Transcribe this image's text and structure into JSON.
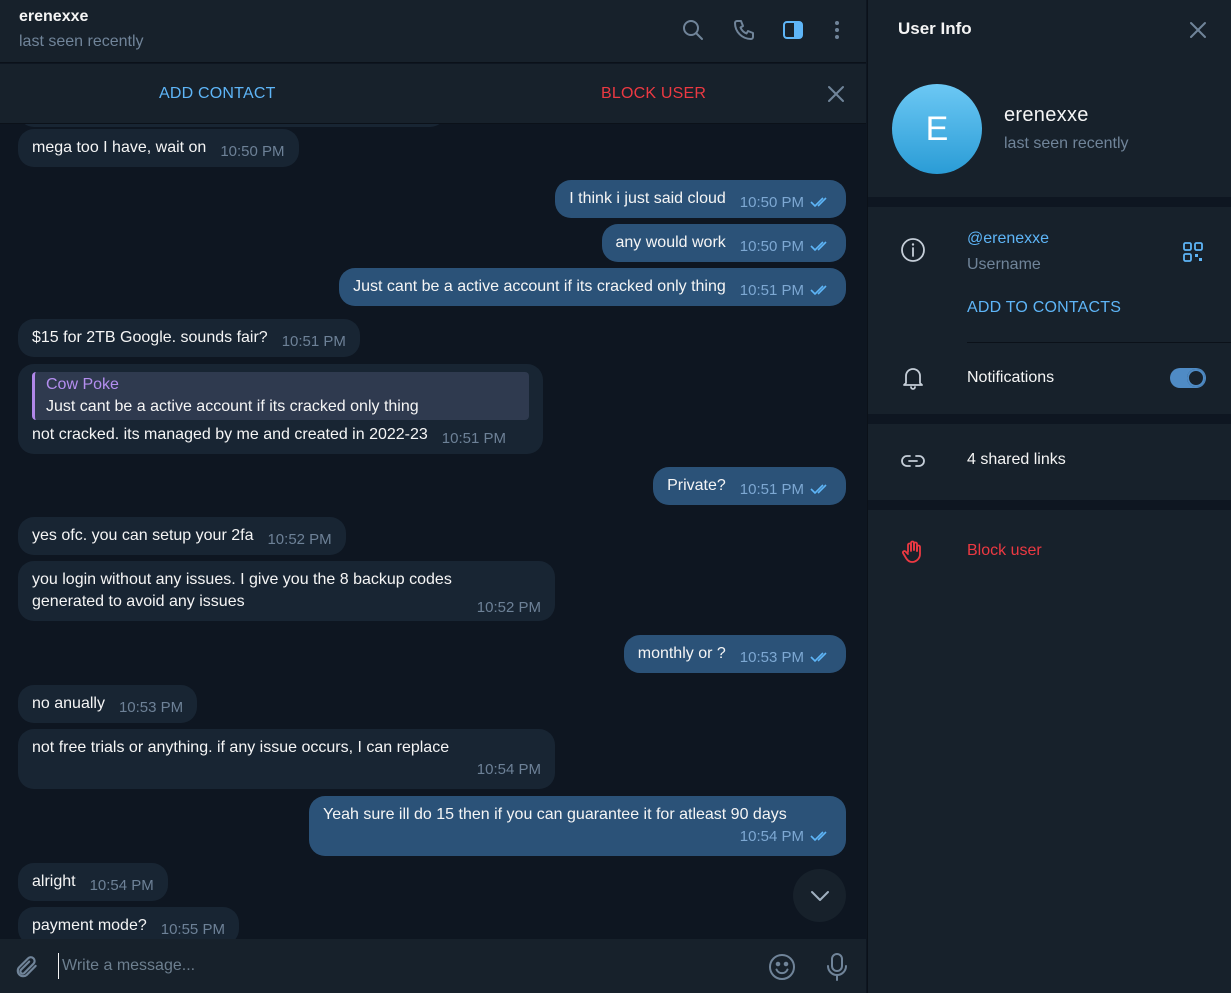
{
  "header": {
    "title": "erenexxe",
    "status": "last seen recently"
  },
  "action_bar": {
    "add_contact": "ADD CONTACT",
    "block_user": "BLOCK USER"
  },
  "messages": [
    {
      "dir": "in",
      "text": "mega too I have, wait on",
      "time": "10:50 PM"
    },
    {
      "dir": "out",
      "text": "I think i just said cloud",
      "time": "10:50 PM"
    },
    {
      "dir": "out",
      "text": "any would work",
      "time": "10:50 PM"
    },
    {
      "dir": "out",
      "text": "Just cant be a active account if its cracked only thing",
      "time": "10:51 PM"
    },
    {
      "dir": "in",
      "text": "$15 for 2TB Google. sounds fair?",
      "time": "10:51 PM"
    },
    {
      "dir": "in",
      "reply_name": "Cow Poke",
      "reply_text": "Just cant be a active account if its cracked only thing",
      "text": "not cracked. its managed by me and created in 2022-23",
      "time": "10:51 PM"
    },
    {
      "dir": "out",
      "text": "Private?",
      "time": "10:51 PM"
    },
    {
      "dir": "in",
      "text": "yes ofc. you can setup your 2fa",
      "time": "10:52 PM"
    },
    {
      "dir": "in",
      "text_line1": "you login without any issues. I give you the 8 backup codes",
      "text_line2": "generated to avoid any issues",
      "time": "10:52 PM"
    },
    {
      "dir": "out",
      "text": "monthly or ?",
      "time": "10:53 PM"
    },
    {
      "dir": "in",
      "text": "no anually",
      "time": "10:53 PM"
    },
    {
      "dir": "in",
      "text": "not free trials or anything. if any issue occurs, I can replace",
      "time": "10:54 PM"
    },
    {
      "dir": "out",
      "text": "Yeah sure ill do 15 then if you can guarantee it for atleast 90 days",
      "time": "10:54 PM"
    },
    {
      "dir": "in",
      "text": "alright",
      "time": "10:54 PM"
    },
    {
      "dir": "in",
      "text": "payment mode?",
      "time": "10:55 PM"
    }
  ],
  "composer": {
    "placeholder": "Write a message..."
  },
  "info": {
    "title": "User Info",
    "avatar_letter": "E",
    "name": "erenexxe",
    "status": "last seen recently",
    "username": "@erenexxe",
    "username_label": "Username",
    "add_to_contacts": "ADD TO CONTACTS",
    "notifications_label": "Notifications",
    "notifications_on": true,
    "shared_links": "4 shared links",
    "block_user": "Block user"
  },
  "colors": {
    "accent": "#5eb5f7",
    "danger": "#ec3942",
    "bubble_in": "#182533",
    "bubble_out": "#2b5278",
    "reply_name": "#b48ef0"
  }
}
